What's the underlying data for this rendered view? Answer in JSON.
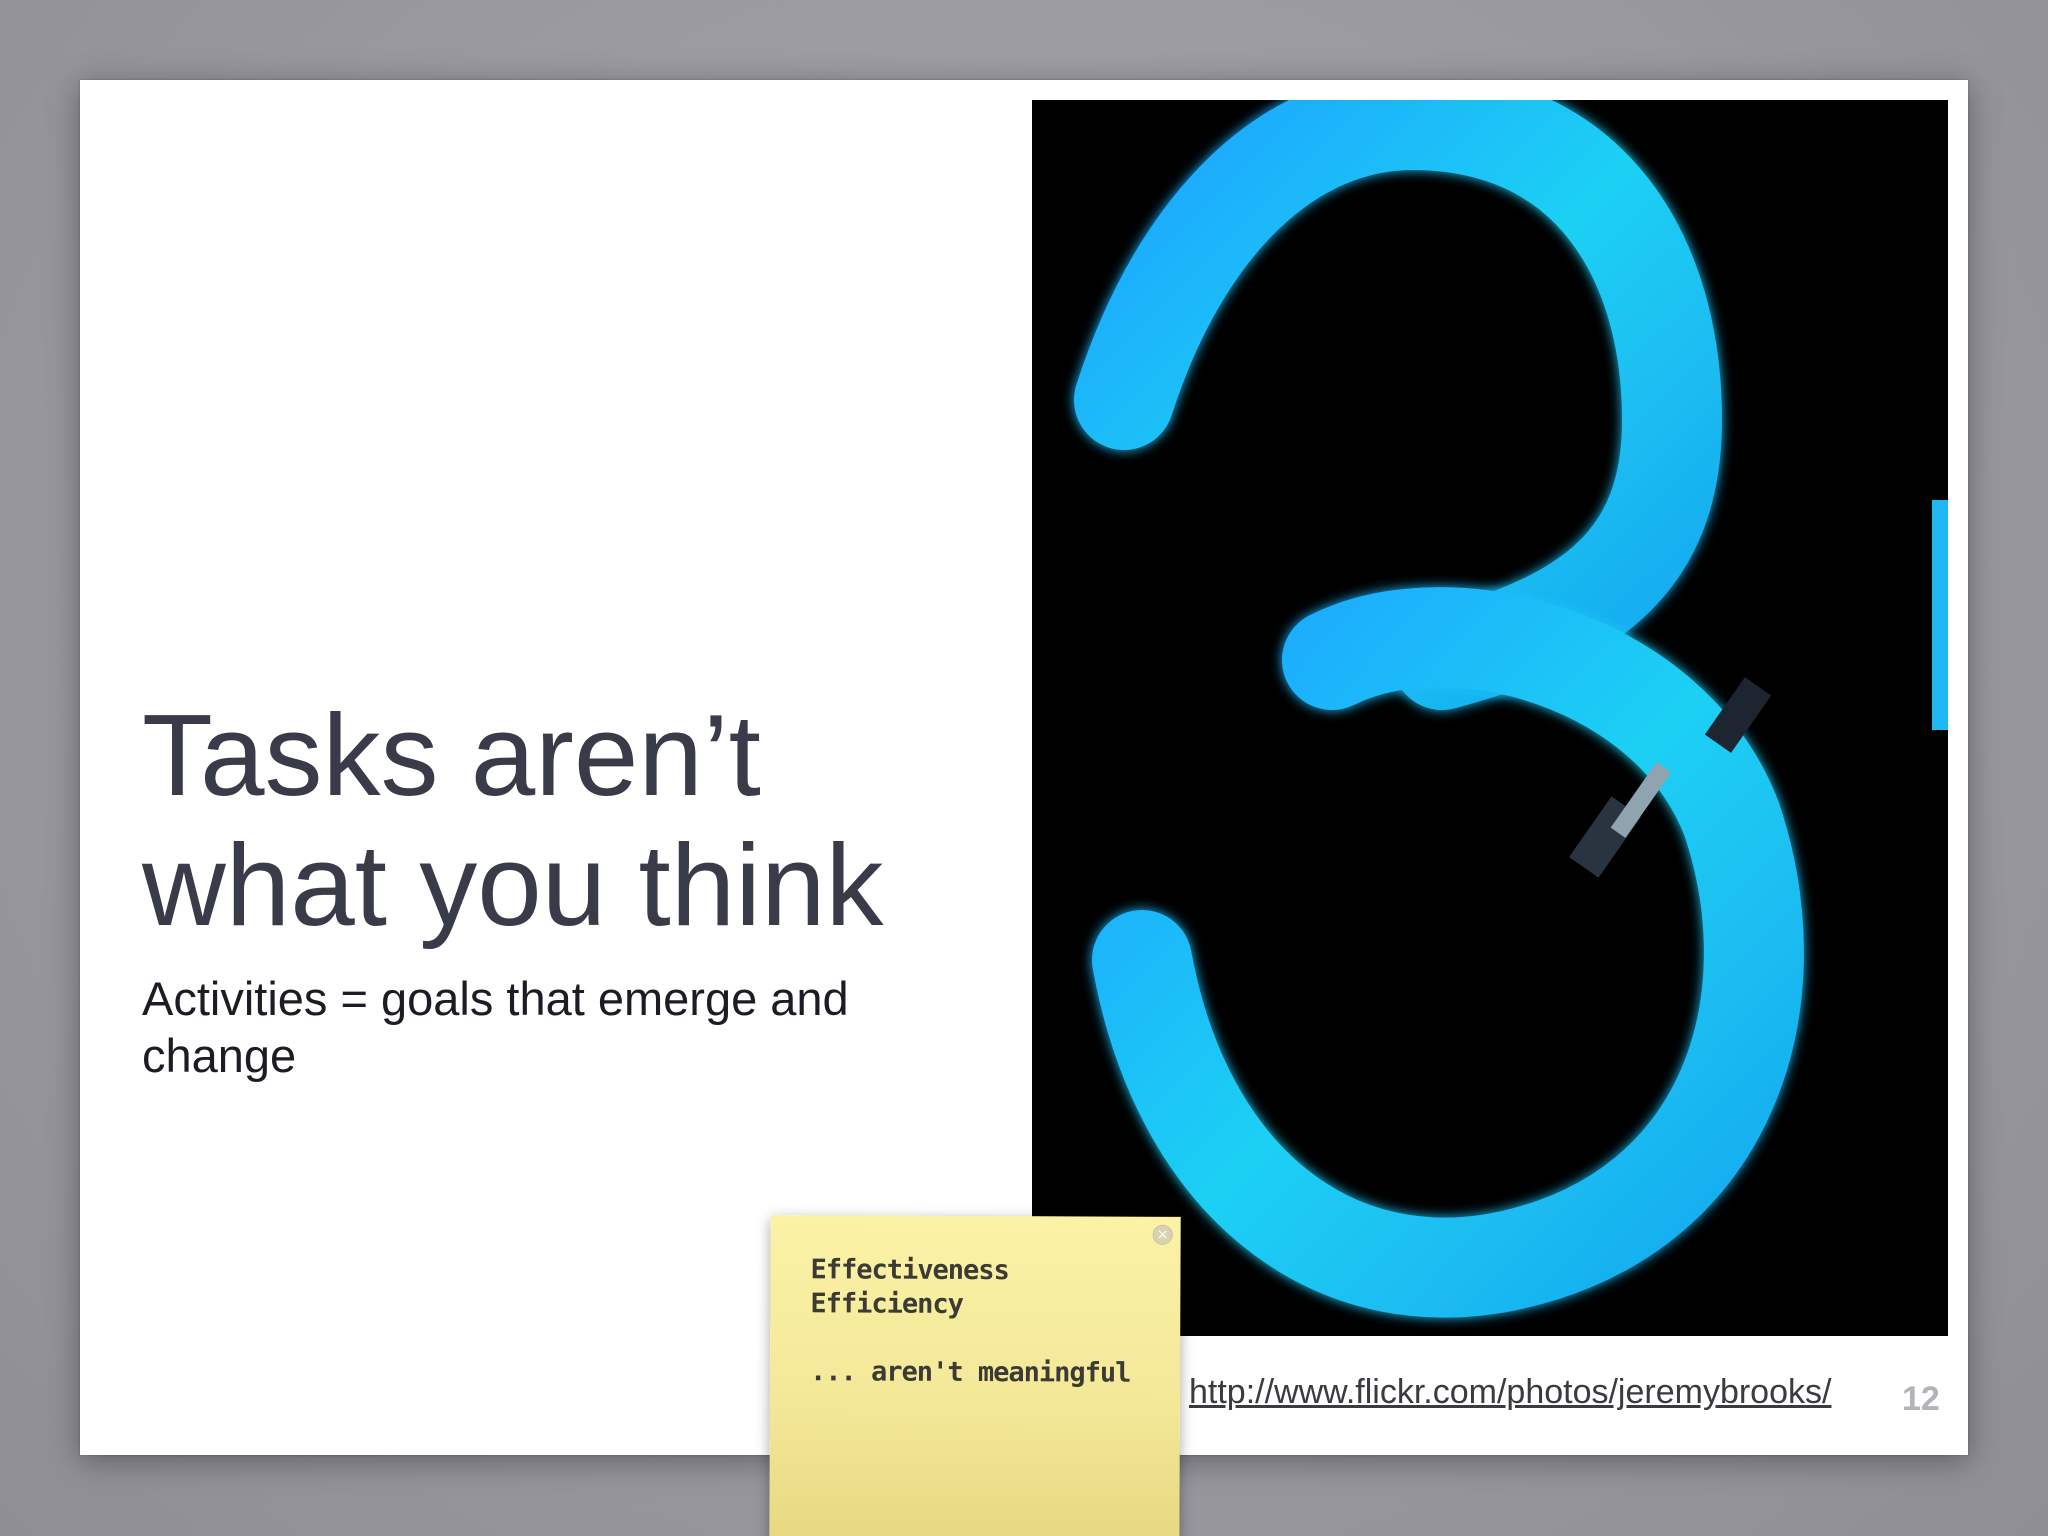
{
  "slide": {
    "title_line1": "Tasks aren’t",
    "title_line2": "what you think",
    "subtitle": "Activities = goals that emerge and change",
    "photo_credit": "http://www.flickr.com/photos/jeremybrooks/",
    "page_number": "12",
    "photo_icon": "neon-number-3-image"
  },
  "sticky_note": {
    "line1": "Effectiveness",
    "line2": "Efficiency",
    "line3": "... aren't meaningful",
    "close_icon": "close-icon"
  },
  "colors": {
    "title": "#3a3b48",
    "neon": "#19c6f2",
    "sticky": "#f3e898",
    "background": "#9d9ca2"
  }
}
